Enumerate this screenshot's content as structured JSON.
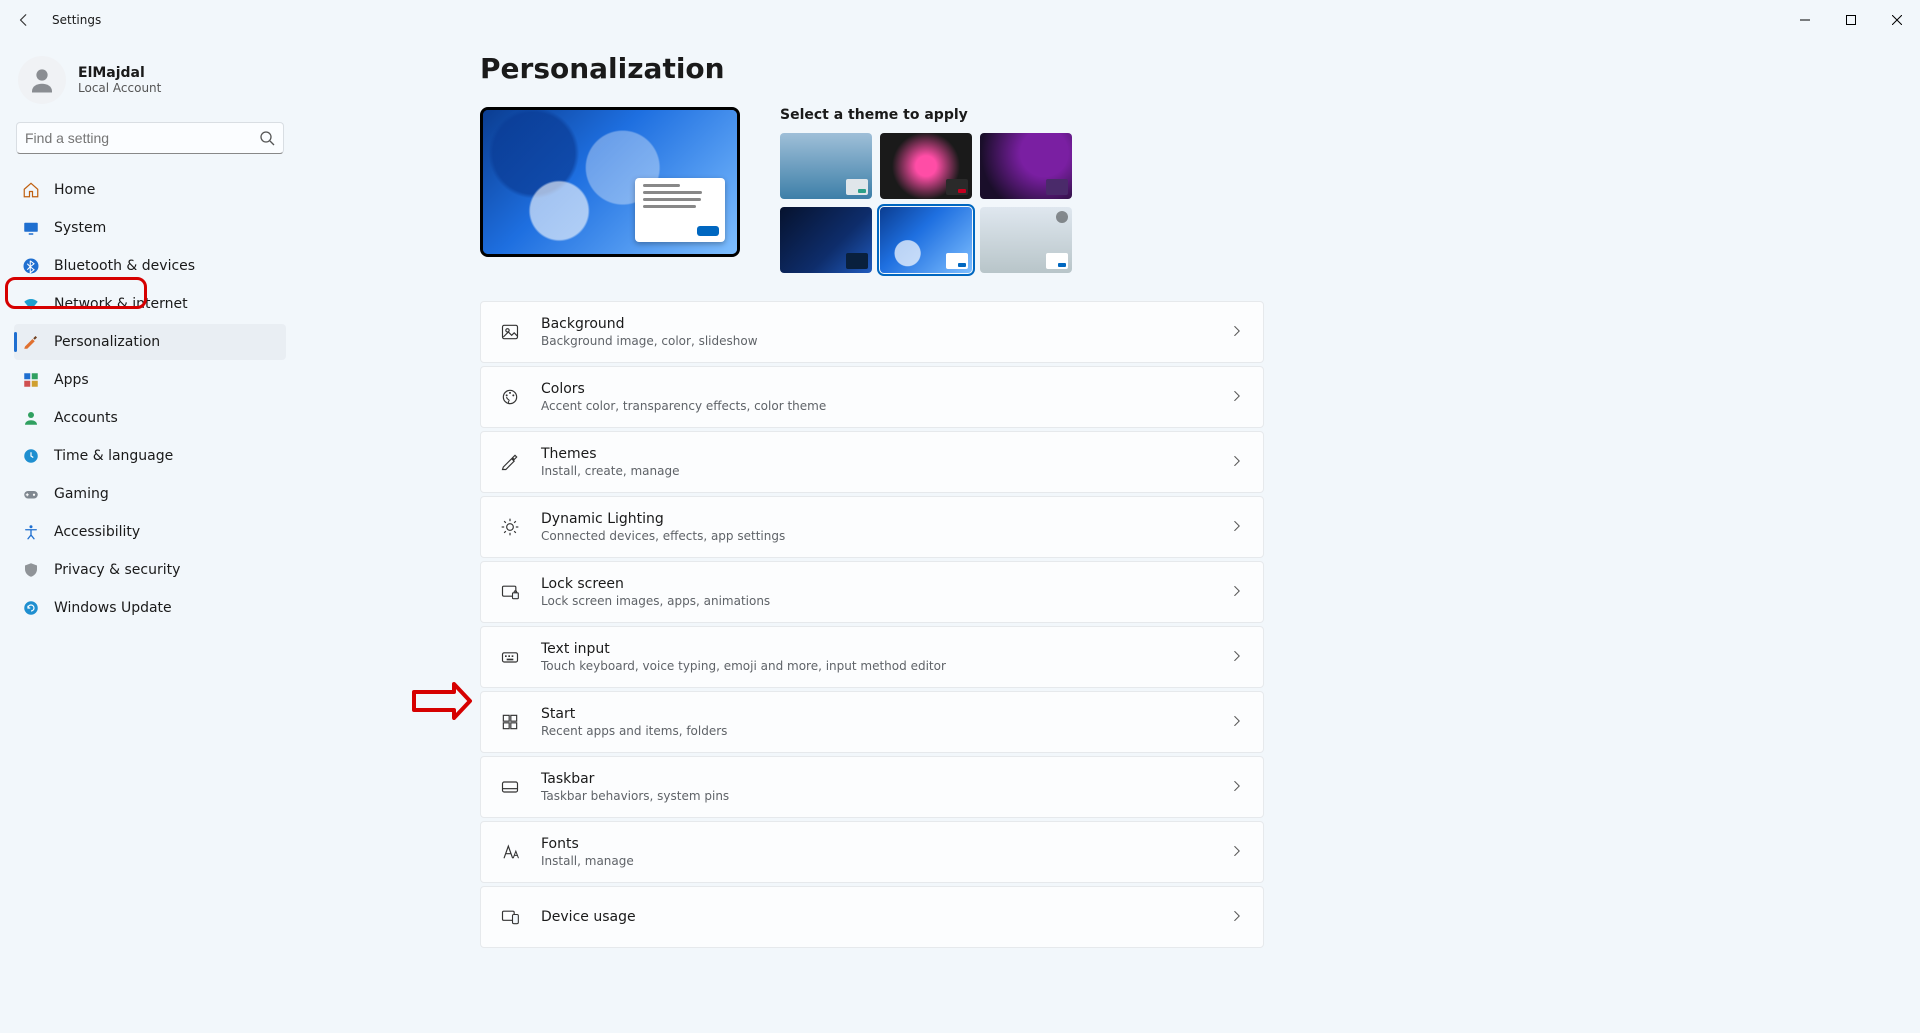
{
  "app_title": "Settings",
  "window_controls": {
    "minimize": "−",
    "maximize": "▢",
    "close": "✕"
  },
  "profile": {
    "name": "ElMajdal",
    "sub": "Local Account"
  },
  "search": {
    "placeholder": "Find a setting"
  },
  "nav": [
    {
      "id": "home",
      "label": "Home",
      "active": false
    },
    {
      "id": "system",
      "label": "System",
      "active": false
    },
    {
      "id": "bluetooth",
      "label": "Bluetooth & devices",
      "active": false
    },
    {
      "id": "network",
      "label": "Network & internet",
      "active": false
    },
    {
      "id": "personalization",
      "label": "Personalization",
      "active": true
    },
    {
      "id": "apps",
      "label": "Apps",
      "active": false
    },
    {
      "id": "accounts",
      "label": "Accounts",
      "active": false
    },
    {
      "id": "time",
      "label": "Time & language",
      "active": false
    },
    {
      "id": "gaming",
      "label": "Gaming",
      "active": false
    },
    {
      "id": "accessibility",
      "label": "Accessibility",
      "active": false
    },
    {
      "id": "privacy",
      "label": "Privacy & security",
      "active": false
    },
    {
      "id": "update",
      "label": "Windows Update",
      "active": false
    }
  ],
  "page": {
    "title": "Personalization",
    "theme_heading": "Select a theme to apply",
    "selected_theme_index": 4,
    "cards": [
      {
        "id": "background",
        "title": "Background",
        "sub": "Background image, color, slideshow"
      },
      {
        "id": "colors",
        "title": "Colors",
        "sub": "Accent color, transparency effects, color theme"
      },
      {
        "id": "themes",
        "title": "Themes",
        "sub": "Install, create, manage"
      },
      {
        "id": "dynamic-lighting",
        "title": "Dynamic Lighting",
        "sub": "Connected devices, effects, app settings"
      },
      {
        "id": "lock-screen",
        "title": "Lock screen",
        "sub": "Lock screen images, apps, animations"
      },
      {
        "id": "text-input",
        "title": "Text input",
        "sub": "Touch keyboard, voice typing, emoji and more, input method editor"
      },
      {
        "id": "start",
        "title": "Start",
        "sub": "Recent apps and items, folders"
      },
      {
        "id": "taskbar",
        "title": "Taskbar",
        "sub": "Taskbar behaviors, system pins"
      },
      {
        "id": "fonts",
        "title": "Fonts",
        "sub": "Install, manage"
      },
      {
        "id": "device-usage",
        "title": "Device usage",
        "sub": ""
      }
    ]
  },
  "annotations": {
    "sidebar_highlight": "personalization",
    "arrow_target": "taskbar"
  }
}
